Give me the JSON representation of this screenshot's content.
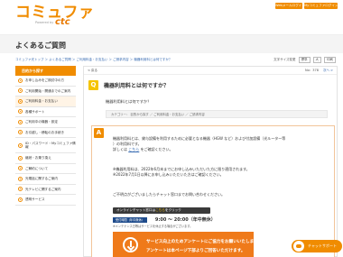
{
  "header": {
    "logo_text": "コミュファ",
    "logo_tag": "Powered by",
    "logo_brand": "ctc",
    "btn_web": "Webメールログイン",
    "btn_my": "Myコミュファログイン"
  },
  "page": {
    "title": "よくあるご質問",
    "breadcrumb": "コミュファ光トップ ＞ よくあるご質問 ＞ ご利用料金・お支払い ＞ ご請求内容 ＞ 機器利用料とは何ですか？",
    "font_size_label": "文字サイズ変更",
    "size_small": "標準",
    "size_large": "大",
    "print_label": "印刷"
  },
  "sidebar": {
    "heading": "目的から探す",
    "items": [
      {
        "label": "お申し込みをご検討中の方"
      },
      {
        "label": "ご利用開始・開通までのご案内"
      },
      {
        "label": "ご利用料金・お支払い"
      },
      {
        "label": "各種サポート"
      },
      {
        "label": "ご利用中の機器・設定"
      },
      {
        "label": "お引越し・移転のお手続き"
      },
      {
        "label": "ID・パスワード・Myコミュファ情報"
      },
      {
        "label": "継続・お乗り換え"
      },
      {
        "label": "ご解約について"
      },
      {
        "label": "光電話に関するご案内"
      },
      {
        "label": "光テレビに関するご案内"
      },
      {
        "label": "透明サービス"
      }
    ]
  },
  "main": {
    "back_label": "< 戻る",
    "pager": "No：378",
    "next_label": "次へ >",
    "q_badge": "Q",
    "q_title": "機器利用料とは何ですか？",
    "question": "機器利用料とは何ですか？",
    "category": "カテゴリー： 目的から探す ／ ご利用料金・お支払い ／ ご請求内容",
    "a_badge": "A",
    "answer_lines": [
      "機器利用料とは、貸与設備を利用するために必要となる機器（HGW など）および付加設備（光ルーター等",
      "）の利用料です。",
      "詳しくは",
      "こちら",
      "をご確認ください。",
      "※機器利用料は、2022年6月末までにお申し込みいただいた方に限り適用されます。",
      "※2022年7月1日以降にお申し込みいただいた方はご確認ください。",
      "ご不明点がございましたらチャット窓口までお問い合わせください。"
    ],
    "chat_btn_prefix": "オンラインチャット窓口は",
    "chat_btn_hl": "こちら",
    "chat_btn_suffix": "をクリック",
    "hours_label": "受付時間（年中無休）",
    "hours_value": "9:00 〜 20:00（年中無休）",
    "hours_note": "※メンテナンス日等はサービスを休止する場合がございます。",
    "survey_line1": "サービス向上のためアンケートにご協力をお願いいたします。",
    "survey_line2": "アンケートは本ページ下部よりご回答いただけます。"
  },
  "chatbot": {
    "label": "チャットサポート"
  }
}
